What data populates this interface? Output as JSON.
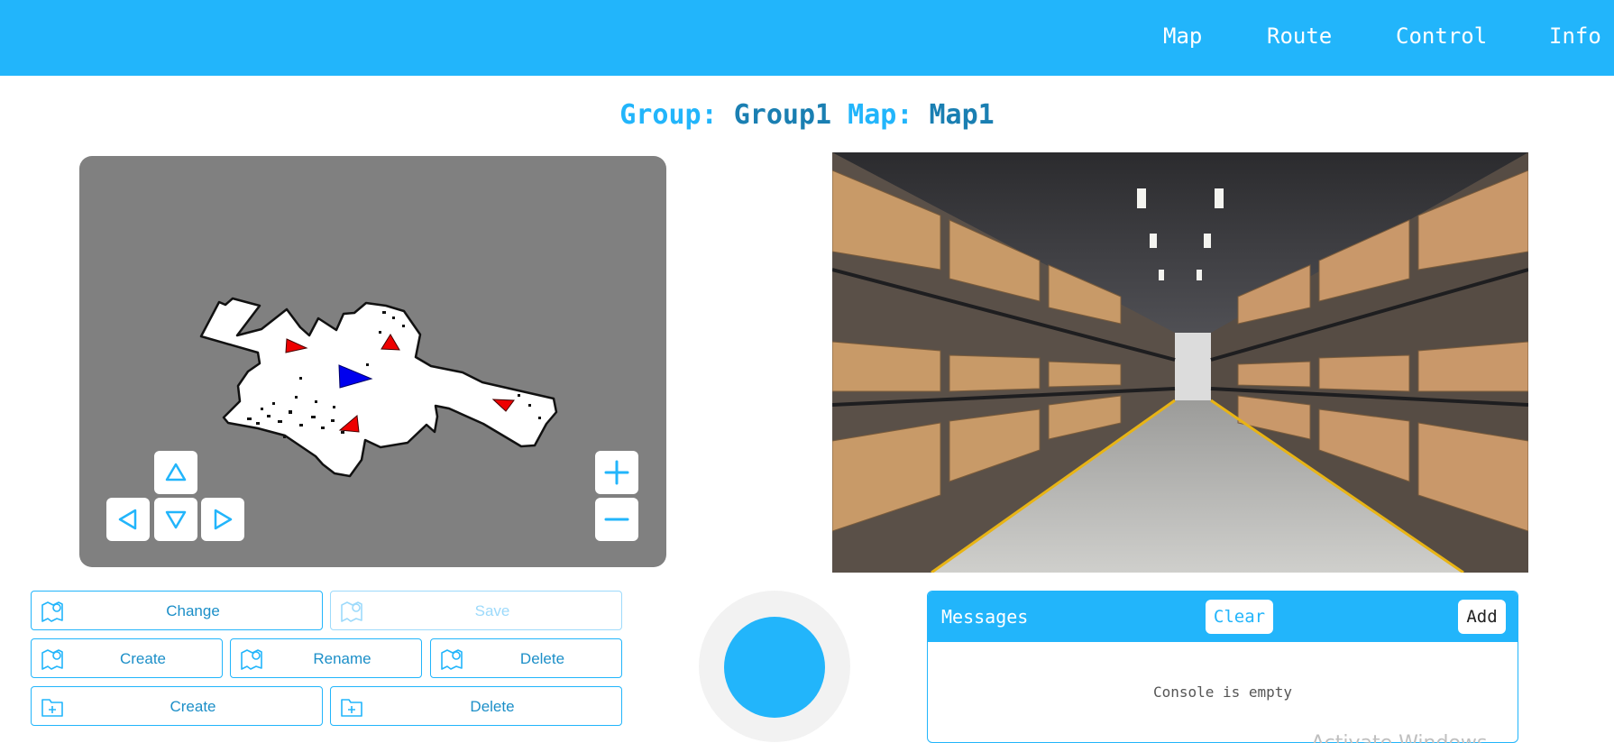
{
  "nav": {
    "items": [
      {
        "label": "Map"
      },
      {
        "label": "Route"
      },
      {
        "label": "Control"
      },
      {
        "label": "Info"
      }
    ]
  },
  "header": {
    "group_label": "Group:",
    "group_value": "Group1",
    "map_label": "Map:",
    "map_value": "Map1"
  },
  "map_controls": {
    "pan_icons": [
      "arrow-up-icon",
      "arrow-left-icon",
      "arrow-down-icon",
      "arrow-right-icon"
    ],
    "zoom_icons": [
      "zoom-in-icon",
      "zoom-out-icon"
    ]
  },
  "map_actions": {
    "change": "Change",
    "save": "Save",
    "create_map": "Create",
    "rename_map": "Rename",
    "delete_map": "Delete",
    "create_group": "Create",
    "delete_group": "Delete",
    "map_icon": "map-pin-icon",
    "group_icon": "folder-plus-icon"
  },
  "messages": {
    "title": "Messages",
    "clear": "Clear",
    "add": "Add",
    "empty": "Console is empty"
  },
  "watermark": "Activate Windows",
  "colors": {
    "accent": "#22b5fb",
    "accent_dark": "#1a7fb2",
    "map_background": "#808080",
    "robot": "#0000ee",
    "waypoint": "#ee0000"
  }
}
